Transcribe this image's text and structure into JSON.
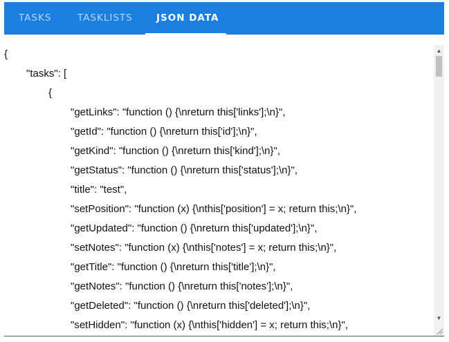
{
  "tabs": [
    {
      "label": "TASKS"
    },
    {
      "label": "TASKLISTS"
    },
    {
      "label": "JSON DATA"
    }
  ],
  "active_tab": "JSON DATA",
  "colors": {
    "tabbar_bg": "#1a7fe0",
    "tab_active": "#ffffff",
    "tab_inactive": "rgba(255,255,255,0.68)"
  },
  "json_lines": [
    "{",
    "\"tasks\": [",
    "{",
    "\"getLinks\": \"function () {\\nreturn this['links'];\\n}\",",
    "\"getId\": \"function () {\\nreturn this['id'];\\n}\",",
    "\"getKind\": \"function () {\\nreturn this['kind'];\\n}\",",
    "\"getStatus\": \"function () {\\nreturn this['status'];\\n}\",",
    "\"title\": \"test\",",
    "\"setPosition\": \"function (x) {\\nthis['position'] = x; return this;\\n}\",",
    "\"getUpdated\": \"function () {\\nreturn this['updated'];\\n}\",",
    "\"setNotes\": \"function (x) {\\nthis['notes'] = x; return this;\\n}\",",
    "\"getTitle\": \"function () {\\nreturn this['title'];\\n}\",",
    "\"getNotes\": \"function () {\\nreturn this['notes'];\\n}\",",
    "\"getDeleted\": \"function () {\\nreturn this['deleted'];\\n}\",",
    "\"setHidden\": \"function (x) {\\nthis['hidden'] = x; return this;\\n}\","
  ]
}
